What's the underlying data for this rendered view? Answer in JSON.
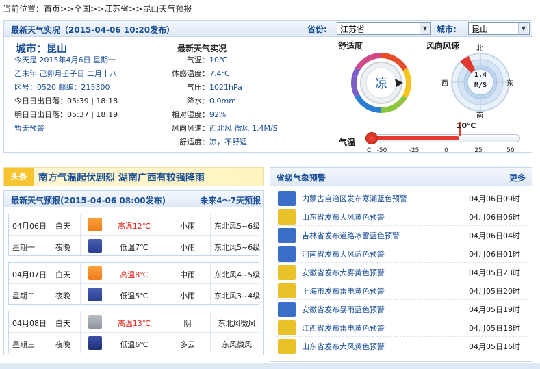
{
  "breadcrumb": [
    "当前位置：",
    "首页",
    ">>",
    "全国",
    ">>",
    "江苏省",
    ">>",
    "昆山天气预报"
  ],
  "live": {
    "title": "最新天气实况（2015-04-06 10:20发布）",
    "province_label": "省份:",
    "province_value": "江苏省",
    "city_label": "城市:",
    "city_value": "昆山",
    "city_name": "城市：昆山",
    "date_line": "今天是 2015年4月6日 星期一",
    "lunar_line": "乙未年 己卯月壬子日 二月十八",
    "codes_line": "区号：0520   邮编：215300",
    "today_sun": "今日日出日落：05:39 | 18:18",
    "tomorrow_sun": "明日日出日落：05:37 | 18:19",
    "warning": "暂无预警",
    "detail_title": "最新天气实况",
    "details": [
      {
        "k": "气温：",
        "v": "10℃"
      },
      {
        "k": "体感温度：",
        "v": "7.4℃"
      },
      {
        "k": "气压：",
        "v": "1021hPa"
      },
      {
        "k": "降水：",
        "v": "0.0mm"
      },
      {
        "k": "相对湿度：",
        "v": "92%"
      },
      {
        "k": "风向风速：",
        "v": "西北风 微风 1.4M/S"
      },
      {
        "k": "舒适度：",
        "v": "凉，不舒适"
      }
    ],
    "comfort_title": "舒适度",
    "comfort_value": "凉",
    "wind_title": "风向风速",
    "wind_dirs": {
      "n": "北",
      "s": "南",
      "e": "东",
      "w": "西"
    },
    "wind_speed": "1.4",
    "wind_unit": "M/S",
    "temp_label": "气温",
    "temp_value": "10℃",
    "temp_scale_unit": "C",
    "temp_ticks": [
      "-50",
      "-25",
      "0",
      "25",
      "50"
    ],
    "temp_level": 10,
    "temp_range": [
      -50,
      50
    ]
  },
  "headline": {
    "tag": "头条",
    "text": "南方气温起伏剧烈 湖南广西有较强降雨"
  },
  "forecast": {
    "title": "最新天气预报(2015-04-06 08:00发布)",
    "more": "未来4～7天预报",
    "days": [
      {
        "date": "04月06日",
        "week": "星期一",
        "day": {
          "label": "白天",
          "icon": "rain-icon",
          "temp": "高温12℃",
          "weather": "小雨",
          "wind": "东北风5~6级"
        },
        "night": {
          "label": "夜晚",
          "icon": "rain-icon",
          "temp": "低温7℃",
          "weather": "小雨",
          "wind": "东北风5~6级"
        }
      },
      {
        "date": "04月07日",
        "week": "星期二",
        "day": {
          "label": "白天",
          "icon": "rain-icon",
          "temp": "高温8℃",
          "weather": "中雨",
          "wind": "东北风4~5级"
        },
        "night": {
          "label": "夜晚",
          "icon": "rain-icon",
          "temp": "低温5℃",
          "weather": "小雨",
          "wind": "东北风3~4级"
        }
      },
      {
        "date": "04月08日",
        "week": "星期三",
        "day": {
          "label": "白天",
          "icon": "cloud-icon",
          "temp": "高温13℃",
          "weather": "阴",
          "wind": "东北风微风"
        },
        "night": {
          "label": "夜晚",
          "icon": "moon-cloud-icon",
          "temp": "低温6℃",
          "weather": "多云",
          "wind": "东风微风"
        }
      }
    ]
  },
  "alerts": {
    "title": "省级气象预警",
    "more": "更多",
    "items": [
      {
        "text": "内蒙古自治区发布寒潮蓝色预警",
        "time": "04月06日09时",
        "color": "#3a6fc8",
        "icon": "cold-wave-icon"
      },
      {
        "text": "山东省发布大风黄色预警",
        "time": "04月06日06时",
        "color": "#e9c22a",
        "icon": "wind-icon"
      },
      {
        "text": "吉林省发布道路冰雪蓝色预警",
        "time": "04月06日04时",
        "color": "#3a6fc8",
        "icon": "road-ice-icon"
      },
      {
        "text": "河南省发布大风蓝色预警",
        "time": "04月06日01时",
        "color": "#3a6fc8",
        "icon": "wind-icon"
      },
      {
        "text": "安徽省发布大雾黄色预警",
        "time": "04月05日23时",
        "color": "#e9c22a",
        "icon": "fog-icon"
      },
      {
        "text": "上海市发布雷电黄色预警",
        "time": "04月05日20时",
        "color": "#e9c22a",
        "icon": "lightning-icon"
      },
      {
        "text": "安徽省发布暴雨蓝色预警",
        "time": "04月05日19时",
        "color": "#3a6fc8",
        "icon": "rainstorm-icon"
      },
      {
        "text": "江西省发布雷电黄色预警",
        "time": "04月05日18时",
        "color": "#e9c22a",
        "icon": "lightning-icon"
      },
      {
        "text": "山东省发布大风黄色预警",
        "time": "04月05日16时",
        "color": "#e9c22a",
        "icon": "wind-icon"
      }
    ]
  }
}
